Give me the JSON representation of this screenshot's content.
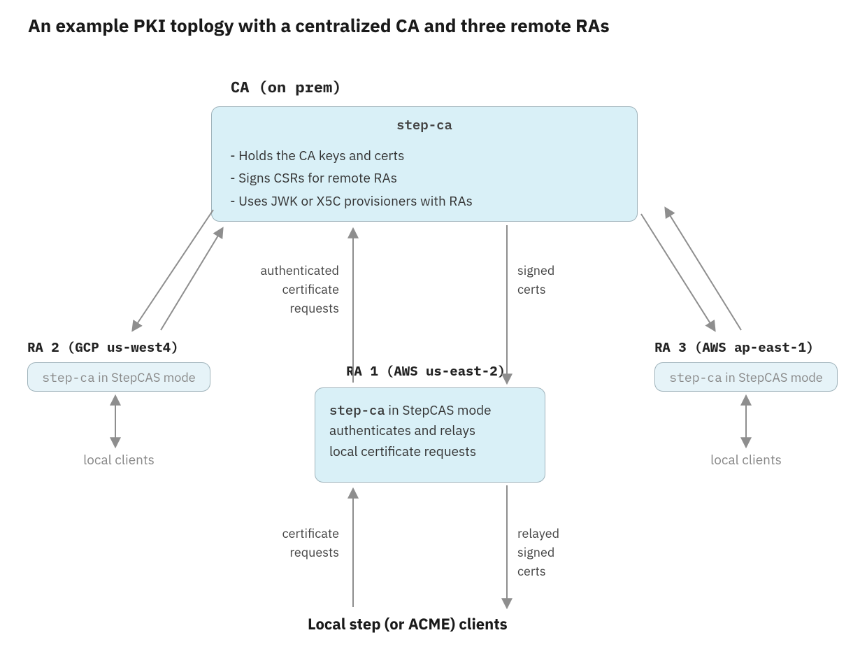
{
  "title": "An example PKI toplogy with a centralized CA and three remote RAs",
  "ca": {
    "heading": "CA (on prem)",
    "box_title": "step-ca",
    "bullets": [
      "- Holds the CA keys and certs",
      "- Signs CSRs for remote RAs",
      "- Uses JWK or X5C provisioners with RAs"
    ]
  },
  "ra1": {
    "heading": "RA 1 (AWS us-east-2)",
    "line1_code": "step-ca",
    "line1_rest": " in StepCAS mode",
    "line2": "authenticates and relays",
    "line3": "local certificate requests"
  },
  "ra2": {
    "heading": "RA 2 (GCP us-west4)",
    "box_code": "step-ca",
    "box_rest": " in StepCAS mode",
    "clients": "local clients"
  },
  "ra3": {
    "heading": "RA 3 (AWS ap-east-1)",
    "box_code": "step-ca",
    "box_rest": " in StepCAS mode",
    "clients": "local clients"
  },
  "labels": {
    "auth_req_1": "authenticated",
    "auth_req_2": "certificate",
    "auth_req_3": "requests",
    "signed_1": "signed",
    "signed_2": "certs",
    "cert_req_1": "certificate",
    "cert_req_2": "requests",
    "relayed_1": "relayed",
    "relayed_2": "signed",
    "relayed_3": "certs"
  },
  "bottom": "Local step (or ACME) clients"
}
